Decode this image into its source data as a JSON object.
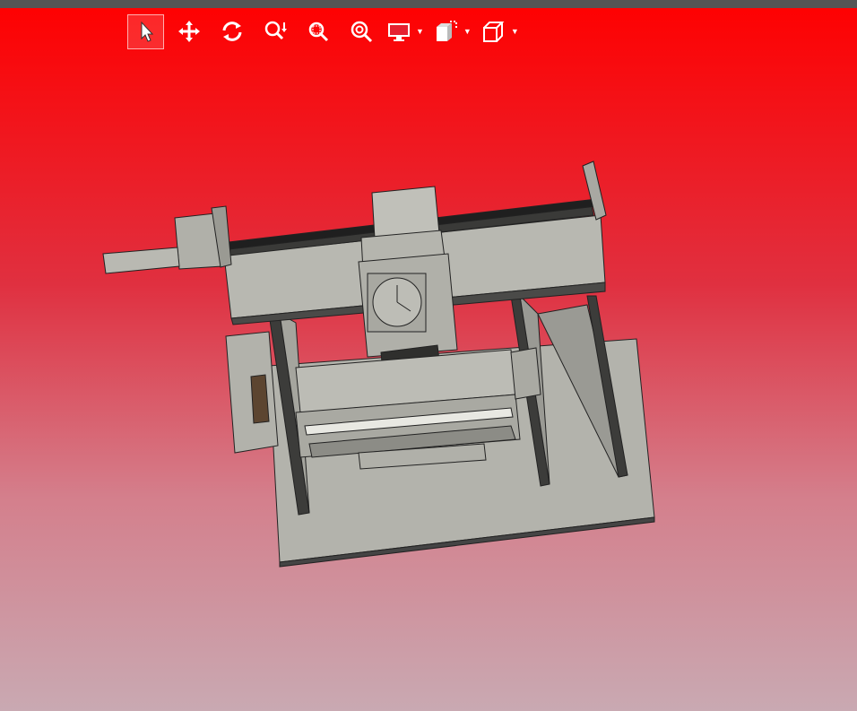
{
  "viewer": {
    "tools": [
      {
        "name": "select",
        "icon": "cursor-arrow-icon",
        "active": true
      },
      {
        "name": "pan",
        "icon": "move-arrows-icon",
        "active": false
      },
      {
        "name": "rotate",
        "icon": "rotate-icon",
        "active": false
      },
      {
        "name": "zoom",
        "icon": "zoom-icon",
        "active": false
      },
      {
        "name": "zoom-window",
        "icon": "zoom-window-icon",
        "active": false
      },
      {
        "name": "zoom-fit",
        "icon": "zoom-fit-icon",
        "active": false
      },
      {
        "name": "display-mode",
        "icon": "monitor-icon",
        "dropdown": true
      },
      {
        "name": "explode",
        "icon": "explode-icon",
        "dropdown": true
      },
      {
        "name": "view-orientation",
        "icon": "cube-icon",
        "dropdown": true
      }
    ],
    "colors": {
      "background_top": "#ff0000",
      "background_bottom": "#c9a9b2",
      "model": "#b5b5ae",
      "model_dark": "#3a3a38"
    }
  }
}
